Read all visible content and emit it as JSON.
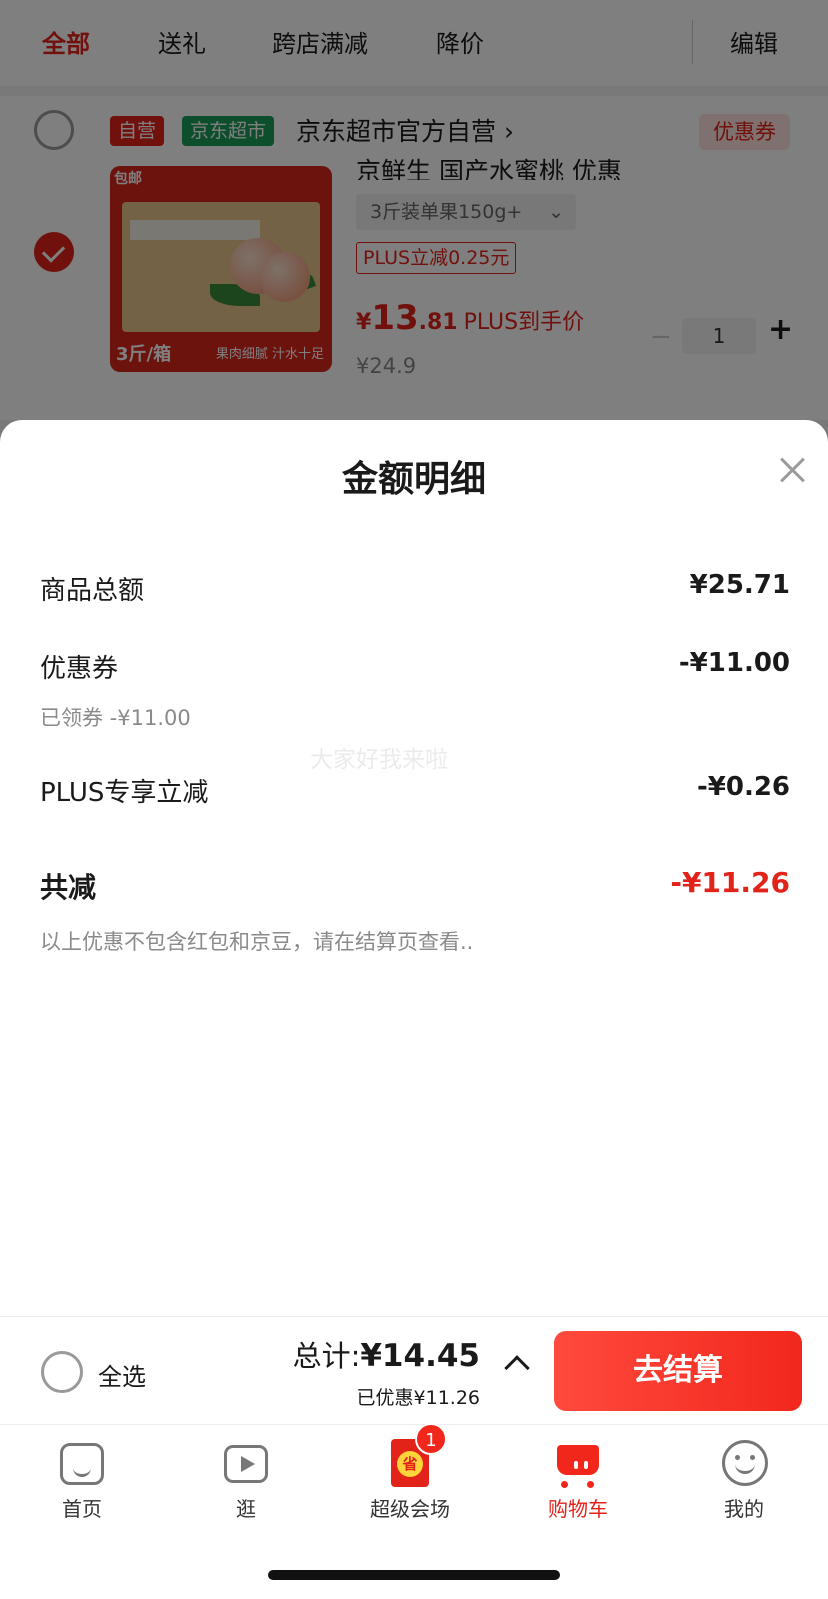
{
  "tabs": [
    {
      "label": "全部",
      "active": true
    },
    {
      "label": "送礼",
      "active": false
    },
    {
      "label": "跨店满减",
      "active": false
    },
    {
      "label": "降价",
      "active": false
    }
  ],
  "edit_label": "编辑",
  "shop": {
    "tag_self": "自营",
    "tag_market": "京东超市",
    "name": "京东超市官方自营 ›",
    "coupon_label": "优惠券"
  },
  "product": {
    "title": "京鲜生 国产水蜜桃 优惠",
    "spec": "3斤装单果150g+",
    "spec_caret": "⌄",
    "plus_tag": "PLUS立减0.25元",
    "price_currency": "¥",
    "price_int": "13",
    "price_dec": ".81",
    "price_label": "PLUS到手价",
    "orig_price": "¥24.9",
    "qty": "1",
    "qty_minus": "−",
    "qty_plus": "+",
    "img_top_left": "包邮",
    "img_bottom_left": "3斤/箱",
    "img_bottom_right": "果肉细腻 汁水十足"
  },
  "sheet": {
    "title": "金额明细",
    "rows": [
      {
        "label": "商品总额",
        "value": "¥25.71"
      },
      {
        "label": "优惠券",
        "value": "-¥11.00",
        "sub": "已领券 -¥11.00"
      },
      {
        "label": "PLUS专享立减",
        "value": "-¥0.26"
      }
    ],
    "total_label": "共减",
    "total_value": "-¥11.26",
    "note": "以上优惠不包含红包和京豆，请在结算页查看..",
    "watermark": "大家好我来啦"
  },
  "checkout": {
    "select_all": "全选",
    "total_prefix": "总计:",
    "total_amount": "¥14.45",
    "saved": "已优惠¥11.26",
    "button": "去结算"
  },
  "nav": [
    {
      "label": "首页",
      "icon": "home-icon",
      "active": false
    },
    {
      "label": "逛",
      "icon": "play-icon",
      "active": false
    },
    {
      "label": "超级会场",
      "icon": "deal-icon",
      "active": false,
      "badge": "1"
    },
    {
      "label": "购物车",
      "icon": "cart-icon",
      "active": true
    },
    {
      "label": "我的",
      "icon": "profile-icon",
      "active": false
    }
  ],
  "colors": {
    "accent": "#e2231a",
    "green_tag": "#1a9c5b"
  }
}
